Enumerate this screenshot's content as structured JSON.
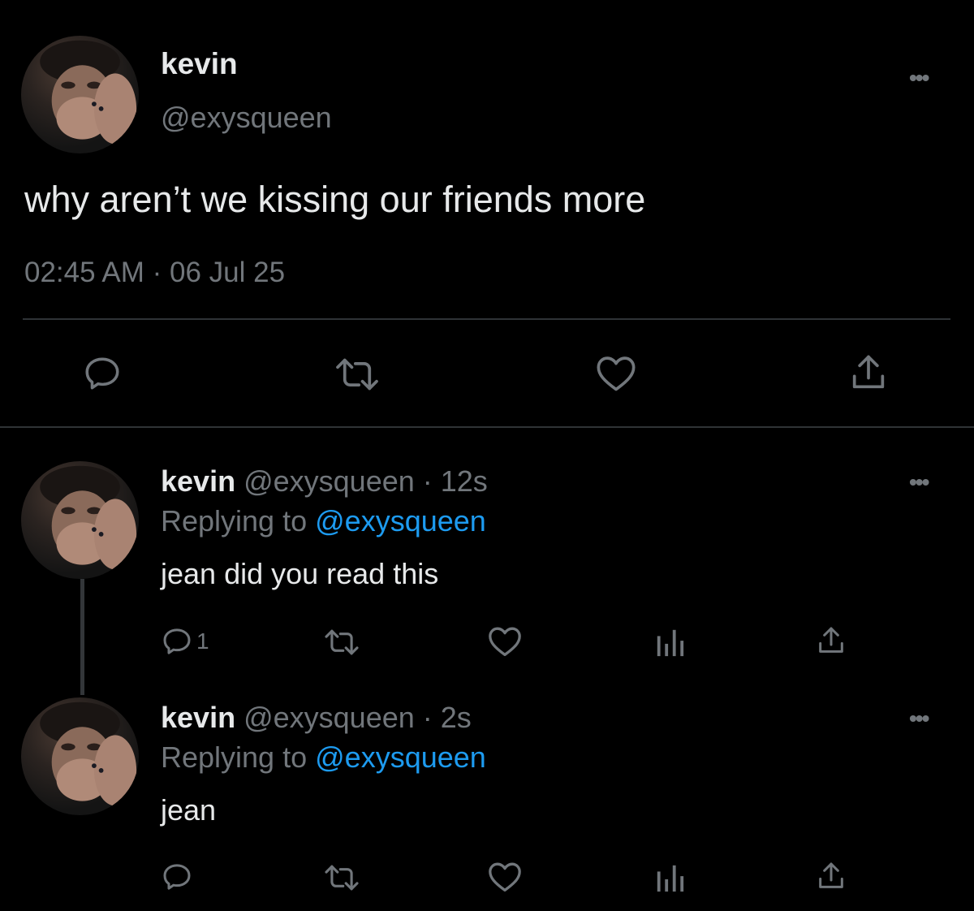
{
  "main_tweet": {
    "name": "kevin",
    "handle": "@exysqueen",
    "text": "why aren’t we kissing our friends more",
    "meta": "02:45 AM · 06 Jul 25",
    "more_icon": "ellipsis-icon"
  },
  "replies": [
    {
      "name": "kevin",
      "handle_time": "@exysqueen · 12s",
      "replying_prefix": "Replying to",
      "replying_to": "@exysqueen",
      "text": "jean did you read this",
      "reply_count": "1"
    },
    {
      "name": "kevin",
      "handle_time": "@exysqueen · 2s",
      "replying_prefix": "Replying to",
      "replying_to": "@exysqueen",
      "text": "jean",
      "reply_count": ""
    }
  ],
  "colors": {
    "background": "#000000",
    "text_primary": "#e7e9ea",
    "text_secondary": "#71767b",
    "accent": "#1d9bf0",
    "divider": "#2f3336"
  },
  "icons": [
    "reply-icon",
    "retweet-icon",
    "like-icon",
    "share-icon",
    "analytics-icon",
    "ellipsis-icon"
  ]
}
